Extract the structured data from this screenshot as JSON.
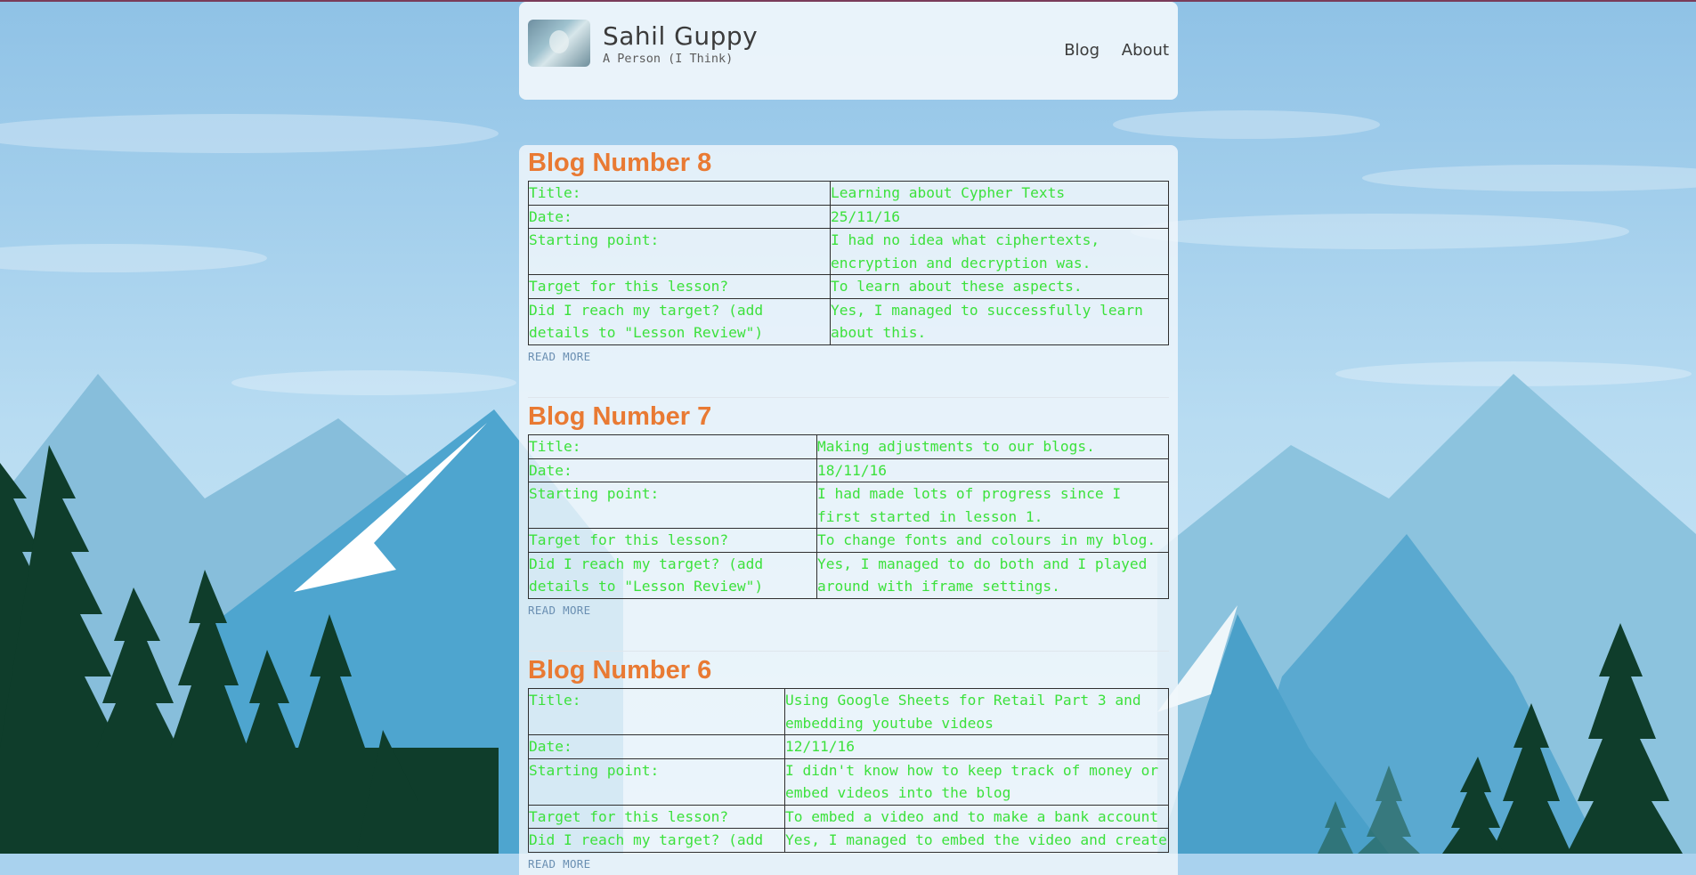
{
  "site": {
    "title": "Sahil Guppy",
    "subtitle": "A Person (I Think)"
  },
  "nav": {
    "items": [
      "Blog",
      "About"
    ]
  },
  "colors": {
    "post_title": "#e97a33",
    "table_text": "#3ce13c",
    "read_more": "#6a8fb2"
  },
  "posts": [
    {
      "title": "Blog Number 8",
      "rows": [
        [
          "Title:",
          "Learning about Cypher Texts"
        ],
        [
          "Date:",
          "25/11/16"
        ],
        [
          "Starting point:",
          "I had no idea what ciphertexts, encryption and decryption was."
        ],
        [
          "Target for this lesson?",
          "To learn about these aspects."
        ],
        [
          "Did I reach my target? (add details to \"Lesson Review\")",
          "Yes, I managed to successfully learn about this."
        ]
      ],
      "read_more": "READ MORE"
    },
    {
      "title": "Blog Number 7",
      "rows": [
        [
          "Title:",
          "Making adjustments to our blogs."
        ],
        [
          "Date:",
          "18/11/16"
        ],
        [
          "Starting point:",
          "I had made lots of progress since I first started in lesson 1."
        ],
        [
          "Target for this lesson?",
          "To change fonts and colours in my blog."
        ],
        [
          "Did I reach my target? (add details to \"Lesson Review\")",
          "Yes, I managed to do both and I played around with iframe settings."
        ]
      ],
      "read_more": "READ MORE"
    },
    {
      "title": "Blog Number 6",
      "rows": [
        [
          "Title:",
          "Using Google Sheets for Retail Part 3 and embedding youtube videos"
        ],
        [
          "Date:",
          "12/11/16"
        ],
        [
          "Starting point:",
          "I didn't know how to keep track of money or embed videos into the blog"
        ],
        [
          "Target for this lesson?",
          "To embed a video and to make a bank account"
        ],
        [
          "Did I reach my target? (add",
          "Yes, I managed to embed the video and create"
        ]
      ],
      "read_more": "READ MORE"
    }
  ]
}
